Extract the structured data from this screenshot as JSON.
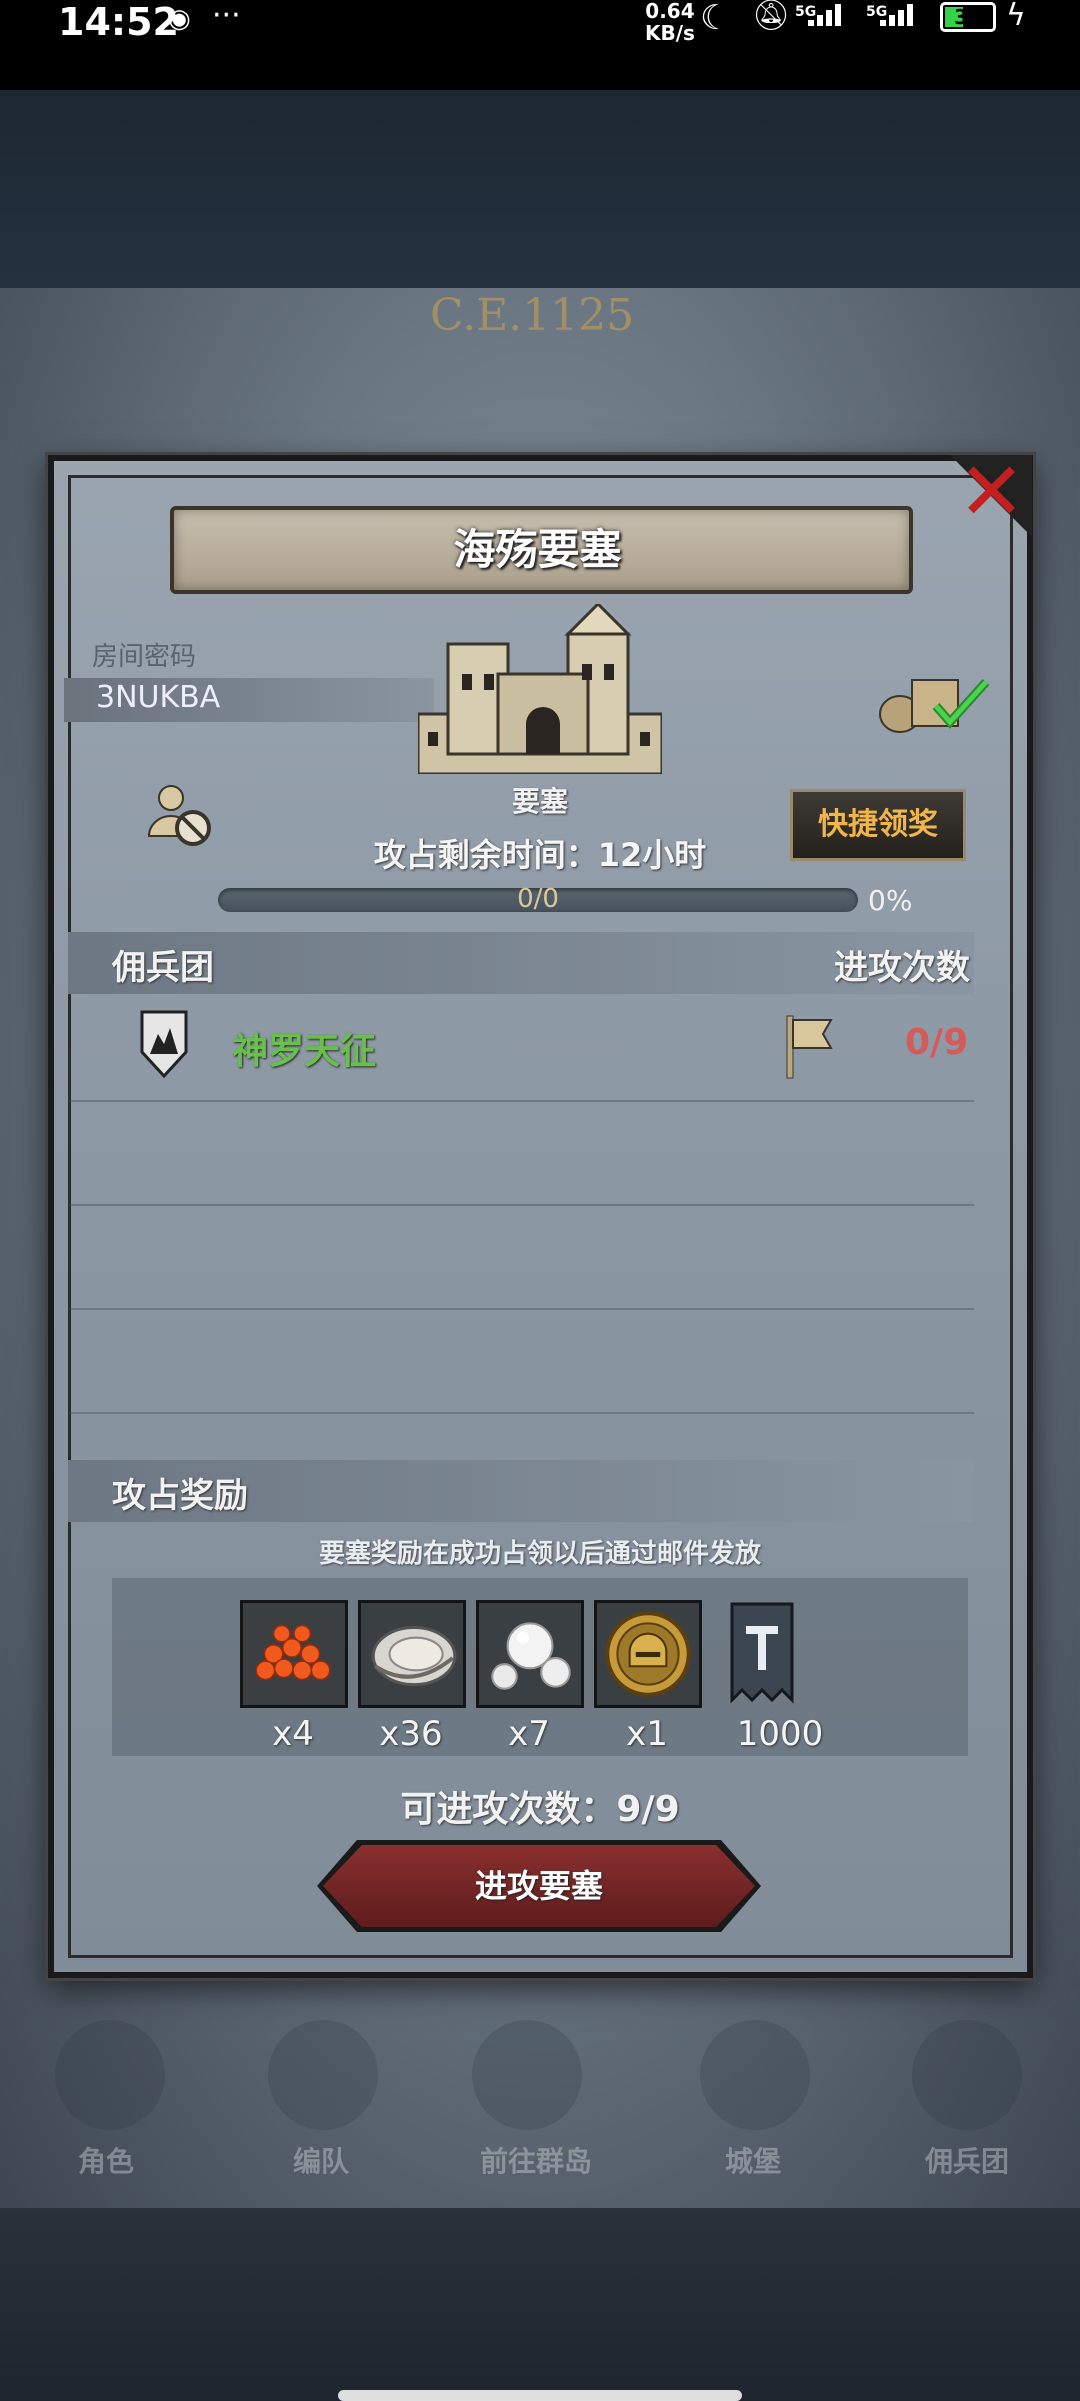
{
  "status_bar": {
    "time": "14:52",
    "net_speed": "0.64",
    "net_unit": "KB/s",
    "net1": "5G",
    "net2": "5G",
    "battery": "39"
  },
  "background": {
    "era": "C.E.1125",
    "nav": [
      "角色",
      "编队",
      "前往群岛",
      "城堡",
      "佣兵团"
    ]
  },
  "dialog": {
    "title": "海殇要塞",
    "room_label": "房间密码",
    "room_code": "3NUKBA",
    "fortress_label": "要塞",
    "time_left": "攻占剩余时间：12小时",
    "quick_claim": "快捷领奖",
    "progress_text": "0/0",
    "progress_pct": "0%",
    "progress_value": 0,
    "mercenary_header": "佣兵团",
    "attack_header": "进攻次数",
    "mercenaries": [
      {
        "name": "神罗天征",
        "attacks": "0/9"
      }
    ],
    "rewards_header": "攻占奖励",
    "rewards_note": "要塞奖励在成功占领以后通过邮件发放",
    "rewards": [
      {
        "icon": "caviar-icon",
        "count": "x4"
      },
      {
        "icon": "oyster-icon",
        "count": "x36"
      },
      {
        "icon": "pearl-icon",
        "count": "x7"
      },
      {
        "icon": "helmet-medal-icon",
        "count": "x1"
      },
      {
        "icon": "banner-icon",
        "count": "1000"
      }
    ],
    "attempts": "可进攻次数：9/9",
    "attack_button": "进攻要塞"
  },
  "colors": {
    "accent_green": "#68c04a",
    "accent_red": "#d55a5a",
    "quick_gold": "#f2b54a",
    "button_red": "#7a2828"
  }
}
